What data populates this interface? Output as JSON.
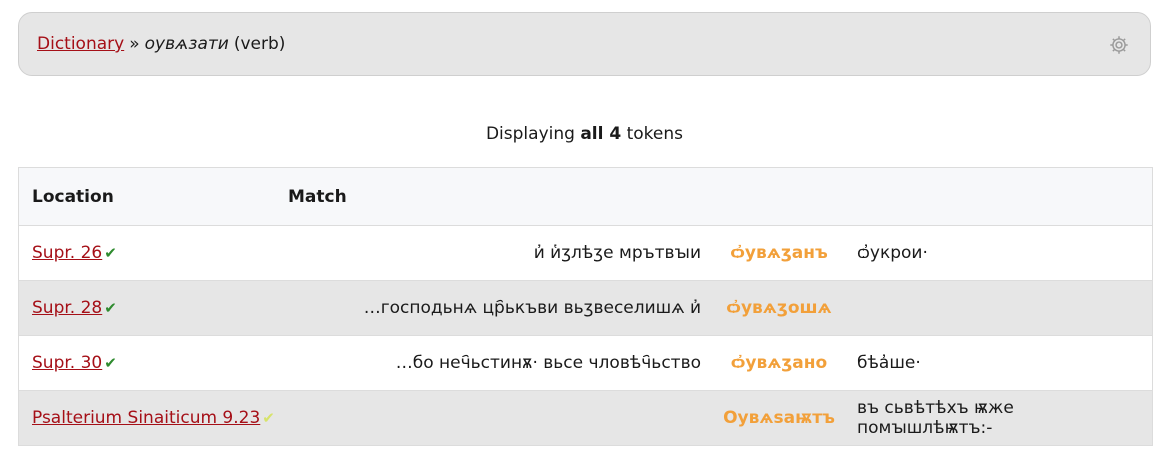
{
  "breadcrumb": {
    "dictionary_link": "Dictionary",
    "separator": "»",
    "lemma": "оувѧзати",
    "pos": "(verb)"
  },
  "settings": {
    "icon": "gear-icon"
  },
  "summary": {
    "prefix": "Displaying",
    "count": "all 4",
    "suffix": "tokens"
  },
  "table": {
    "headers": {
      "location": "Location",
      "match": "Match"
    },
    "rows": [
      {
        "location": "Supr. 26",
        "status": "verified",
        "left": "и҆ и҅ʒлѣʒе мрътвꙑи",
        "hit": "ѻ҆увѧʒанъ",
        "right": "ѻ҆укрои·"
      },
      {
        "location": "Supr. 28",
        "status": "verified",
        "left": "…господьнѧ цр҄ькъви вьʒвеселишѧ и҆",
        "hit": "ѻ҆увѧʒошѧ",
        "right": ""
      },
      {
        "location": "Supr. 30",
        "status": "verified",
        "left": "…бо неч҄ьстинѫ· вьсе чловѣч҄ьство",
        "hit": "ѻ҆увѧʒано",
        "right": "бѣа҆ше·"
      },
      {
        "location": "Psalterium Sinaiticum 9.23",
        "status": "partial",
        "left": "",
        "hit": "Оувѧѕаѭтъ",
        "right": "въ сьвѣтѣхъ ѭже помꙑшлѣѭтъ:-"
      }
    ]
  },
  "colors": {
    "link": "#a50f17",
    "hit": "#f2a03a",
    "check_verified": "#2e8b2e",
    "check_partial": "#d7e36b"
  }
}
